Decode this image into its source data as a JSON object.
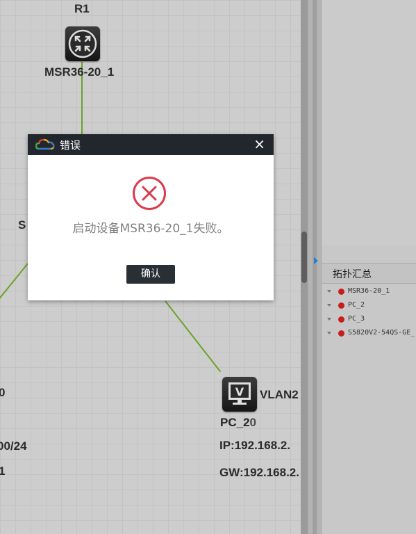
{
  "topology": {
    "router": {
      "name": "R1",
      "model": "MSR36-20_1",
      "icon": "router-icon"
    },
    "pc": {
      "vlan_label": "VLAN2",
      "name_overlay": "PC_2",
      "name": "PC_20",
      "ip": "IP:192.168.2.",
      "gw": "GW:192.168.2.",
      "icon": "monitor-icon"
    },
    "partial_labels": {
      "switch_initial": "S",
      "left_0": "0",
      "left_mask": "00/24",
      "left_1": "1"
    },
    "link_color": "#6aa32a"
  },
  "dialog": {
    "title": "错误",
    "close_label": "×",
    "message": "启动设备MSR36-20_1失败。",
    "confirm_label": "确认",
    "icon": "error-x-icon",
    "accent": "#db3a4b"
  },
  "summary_panel": {
    "title": "拓扑汇总",
    "items": [
      {
        "label": "MSR36-20_1",
        "status_color": "#c81d1d"
      },
      {
        "label": "PC_2",
        "status_color": "#c81d1d"
      },
      {
        "label": "PC_3",
        "status_color": "#c81d1d"
      },
      {
        "label": "S5820V2-54QS-GE_",
        "status_color": "#c81d1d"
      }
    ]
  }
}
